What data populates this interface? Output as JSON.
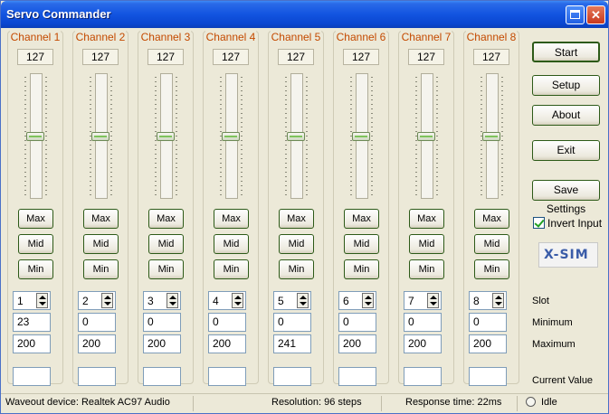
{
  "window": {
    "title": "Servo Commander",
    "restore_icon": "restore-icon",
    "close_icon": "close-icon"
  },
  "channels": [
    {
      "label": "Channel 1",
      "value": "127",
      "slot": "1",
      "minimum": "23",
      "maximum": "200",
      "current": ""
    },
    {
      "label": "Channel 2",
      "value": "127",
      "slot": "2",
      "minimum": "0",
      "maximum": "200",
      "current": ""
    },
    {
      "label": "Channel 3",
      "value": "127",
      "slot": "3",
      "minimum": "0",
      "maximum": "200",
      "current": ""
    },
    {
      "label": "Channel 4",
      "value": "127",
      "slot": "4",
      "minimum": "0",
      "maximum": "200",
      "current": ""
    },
    {
      "label": "Channel 5",
      "value": "127",
      "slot": "5",
      "minimum": "0",
      "maximum": "241",
      "current": ""
    },
    {
      "label": "Channel 6",
      "value": "127",
      "slot": "6",
      "minimum": "0",
      "maximum": "200",
      "current": ""
    },
    {
      "label": "Channel 7",
      "value": "127",
      "slot": "7",
      "minimum": "0",
      "maximum": "200",
      "current": ""
    },
    {
      "label": "Channel 8",
      "value": "127",
      "slot": "8",
      "minimum": "0",
      "maximum": "200",
      "current": ""
    }
  ],
  "slider": {
    "min": 0,
    "max": 255
  },
  "channel_buttons": {
    "max": "Max",
    "mid": "Mid",
    "min": "Min"
  },
  "actions": {
    "start": "Start",
    "setup": "Setup",
    "about": "About",
    "exit": "Exit",
    "save_settings": "Save Settings"
  },
  "invert_input": {
    "label": "Invert Input",
    "checked": true
  },
  "logo_text": "X-SIM",
  "row_labels": {
    "slot": "Slot",
    "minimum": "Minimum",
    "maximum": "Maximum",
    "current_value": "Current Value"
  },
  "status": {
    "waveout": "Waveout device: Realtek AC97 Audio",
    "resolution": "Resolution: 96 steps",
    "response": "Response time: 22ms",
    "state": "Idle"
  },
  "colors": {
    "channel_label": "#c44a00",
    "titlebar": "#0a46d0",
    "checkmark": "#21a121"
  }
}
